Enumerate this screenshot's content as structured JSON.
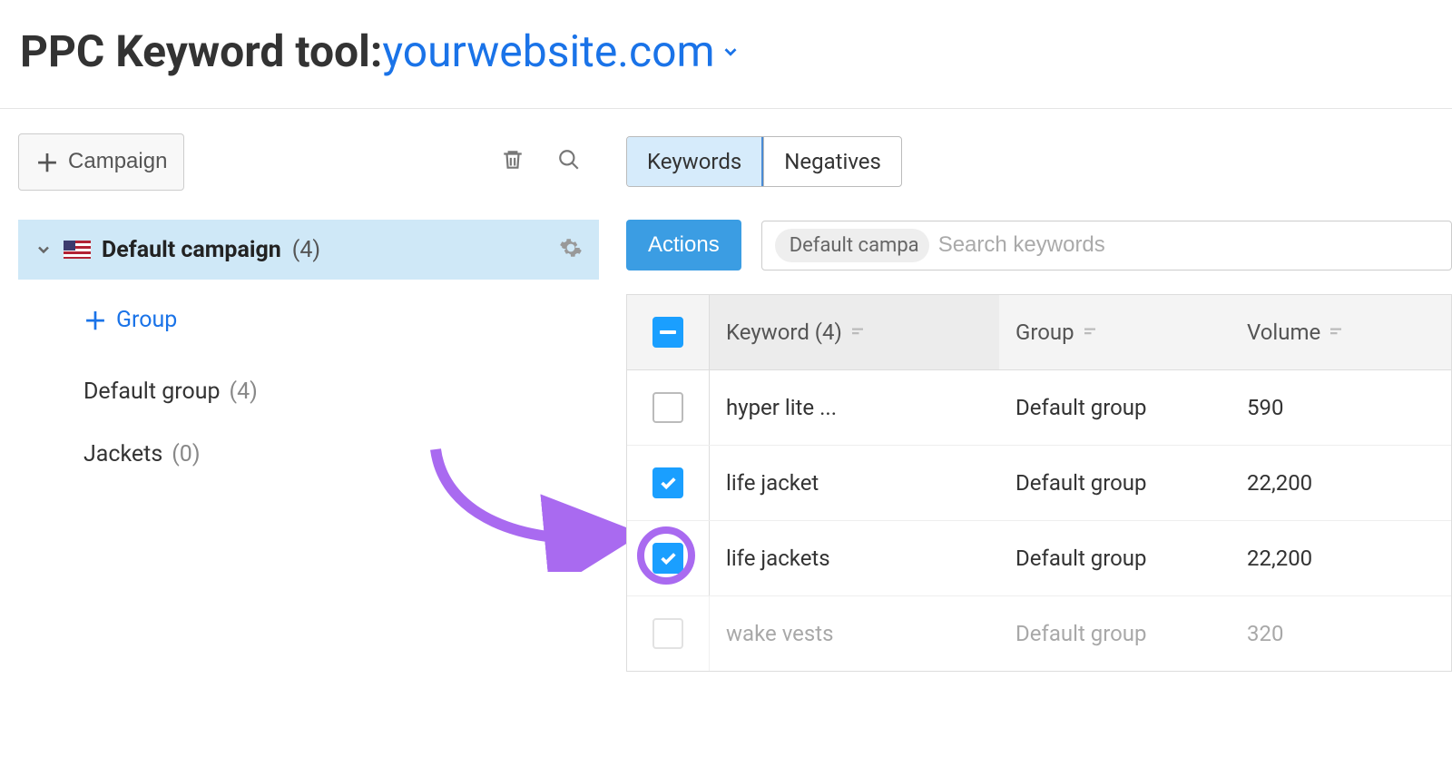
{
  "header": {
    "title_prefix": "PPC Keyword tool:",
    "domain": "yourwebsite.com"
  },
  "left": {
    "add_campaign_label": "Campaign",
    "campaign": {
      "name": "Default campaign",
      "count": "(4)"
    },
    "add_group_label": "Group",
    "groups": [
      {
        "name": "Default group",
        "count": "(4)"
      },
      {
        "name": "Jackets",
        "count": "(0)"
      }
    ]
  },
  "tabs": {
    "keywords": "Keywords",
    "negatives": "Negatives"
  },
  "actions": {
    "button": "Actions",
    "chip": "Default campa",
    "search_placeholder": "Search keywords"
  },
  "table": {
    "headers": {
      "keyword": "Keyword (4)",
      "group": "Group",
      "volume": "Volume"
    },
    "rows": [
      {
        "keyword": "hyper lite ...",
        "group": "Default group",
        "volume": "590",
        "checked": false,
        "highlight": false,
        "faded": false
      },
      {
        "keyword": "life jacket",
        "group": "Default group",
        "volume": "22,200",
        "checked": true,
        "highlight": true,
        "faded": false
      },
      {
        "keyword": "life jackets",
        "group": "Default group",
        "volume": "22,200",
        "checked": true,
        "highlight": false,
        "faded": false
      },
      {
        "keyword": "wake vests",
        "group": "Default group",
        "volume": "320",
        "checked": false,
        "highlight": false,
        "faded": true
      }
    ]
  }
}
